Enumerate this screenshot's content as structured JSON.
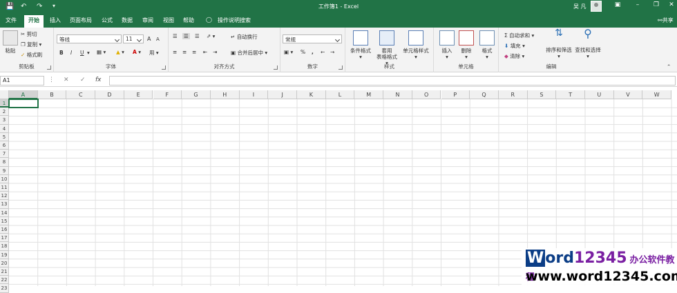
{
  "window": {
    "title": "工作簿1 - Excel",
    "user": "吴 凡",
    "share_label": "共享"
  },
  "tabs": [
    "文件",
    "开始",
    "插入",
    "页面布局",
    "公式",
    "数据",
    "审阅",
    "视图",
    "帮助"
  ],
  "tell_me": "操作说明搜索",
  "ribbon": {
    "clipboard": {
      "group": "剪贴板",
      "paste": "粘贴",
      "cut": "剪切",
      "copy": "复制",
      "format_painter": "格式刷"
    },
    "font": {
      "group": "字体",
      "font_name": "等线",
      "font_size": "11",
      "bold": "B",
      "italic": "I",
      "underline": "U",
      "grow": "A",
      "shrink": "A"
    },
    "alignment": {
      "group": "对齐方式",
      "wrap": "自动换行",
      "merge": "合并后居中"
    },
    "number": {
      "group": "数字",
      "format": "常规",
      "percent": "%",
      "comma": ","
    },
    "styles": {
      "group": "样式",
      "conditional": "条件格式",
      "table_l1": "套用",
      "table_l2": "表格格式",
      "cell_styles": "单元格样式"
    },
    "cells": {
      "group": "单元格",
      "insert": "插入",
      "delete": "删除",
      "format": "格式"
    },
    "editing": {
      "group": "编辑",
      "autosum": "自动求和",
      "fill": "填充",
      "clear": "清除",
      "sort": "排序和筛选",
      "find": "查找和选择"
    }
  },
  "formula_bar": {
    "name_box": "A1",
    "fx": "fx",
    "value": ""
  },
  "columns": [
    "A",
    "B",
    "C",
    "D",
    "E",
    "F",
    "G",
    "H",
    "I",
    "J",
    "K",
    "L",
    "M",
    "N",
    "O",
    "P",
    "Q",
    "R",
    "S",
    "T",
    "U",
    "V",
    "W"
  ],
  "rows": [
    "1",
    "2",
    "3",
    "4",
    "5",
    "6",
    "7",
    "8",
    "9",
    "10",
    "11",
    "12",
    "13",
    "14",
    "15",
    "16",
    "17",
    "18",
    "19",
    "20",
    "21",
    "22",
    "23"
  ],
  "selected_cell": "A1",
  "colors": {
    "accent": "#217346",
    "grid": "#e1e1e1"
  },
  "watermark": {
    "word": "W",
    "rest": "ord",
    "num": "12345",
    "cn": "办公软件教程",
    "url": "www.word12345.com"
  }
}
